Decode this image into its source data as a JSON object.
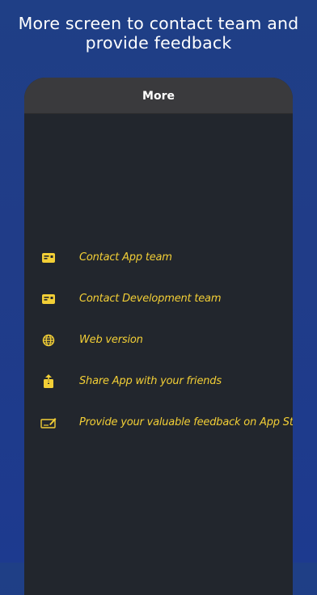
{
  "promo": {
    "line1": "More screen to contact team and",
    "line2": "provide feedback"
  },
  "nav": {
    "title": "More"
  },
  "menu": {
    "items": [
      {
        "label": "Contact App team",
        "icon": "contact-card-icon"
      },
      {
        "label": "Contact Development team",
        "icon": "contact-card-icon"
      },
      {
        "label": "Web version",
        "icon": "globe-icon"
      },
      {
        "label": "Share App with your friends",
        "icon": "share-icon"
      },
      {
        "label": "Provide your valuable feedback on App Store",
        "icon": "feedback-sign-icon"
      }
    ]
  },
  "colors": {
    "background": "#1f3f86",
    "panel": "#22262d",
    "nav_bar": "#3a3a3d",
    "accent_yellow": "#f3cf36"
  }
}
